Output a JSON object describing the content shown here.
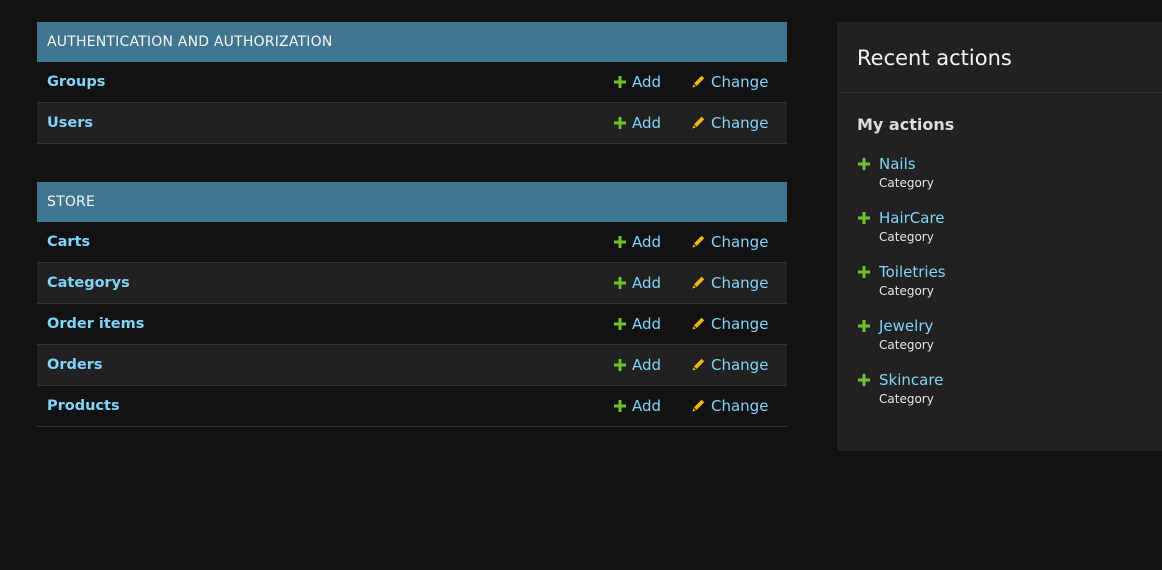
{
  "colors": {
    "background": "#121212",
    "module_header": "#417690",
    "link": "#81d4fa",
    "add_icon": "#70bf2b",
    "change_icon": "#efb80b",
    "panel": "#212121"
  },
  "modules": [
    {
      "title": "AUTHENTICATION AND AUTHORIZATION",
      "models": [
        {
          "name": "Groups",
          "add": "Add",
          "change": "Change"
        },
        {
          "name": "Users",
          "add": "Add",
          "change": "Change"
        }
      ]
    },
    {
      "title": "STORE",
      "models": [
        {
          "name": "Carts",
          "add": "Add",
          "change": "Change"
        },
        {
          "name": "Categorys",
          "add": "Add",
          "change": "Change"
        },
        {
          "name": "Order items",
          "add": "Add",
          "change": "Change"
        },
        {
          "name": "Orders",
          "add": "Add",
          "change": "Change"
        },
        {
          "name": "Products",
          "add": "Add",
          "change": "Change"
        }
      ]
    }
  ],
  "recent": {
    "title": "Recent actions",
    "subtitle": "My actions",
    "items": [
      {
        "label": "Nails",
        "type": "Category",
        "icon": "plus-icon"
      },
      {
        "label": "HairCare",
        "type": "Category",
        "icon": "plus-icon"
      },
      {
        "label": "Toiletries",
        "type": "Category",
        "icon": "plus-icon"
      },
      {
        "label": "Jewelry",
        "type": "Category",
        "icon": "plus-icon"
      },
      {
        "label": "Skincare",
        "type": "Category",
        "icon": "plus-icon"
      }
    ]
  }
}
